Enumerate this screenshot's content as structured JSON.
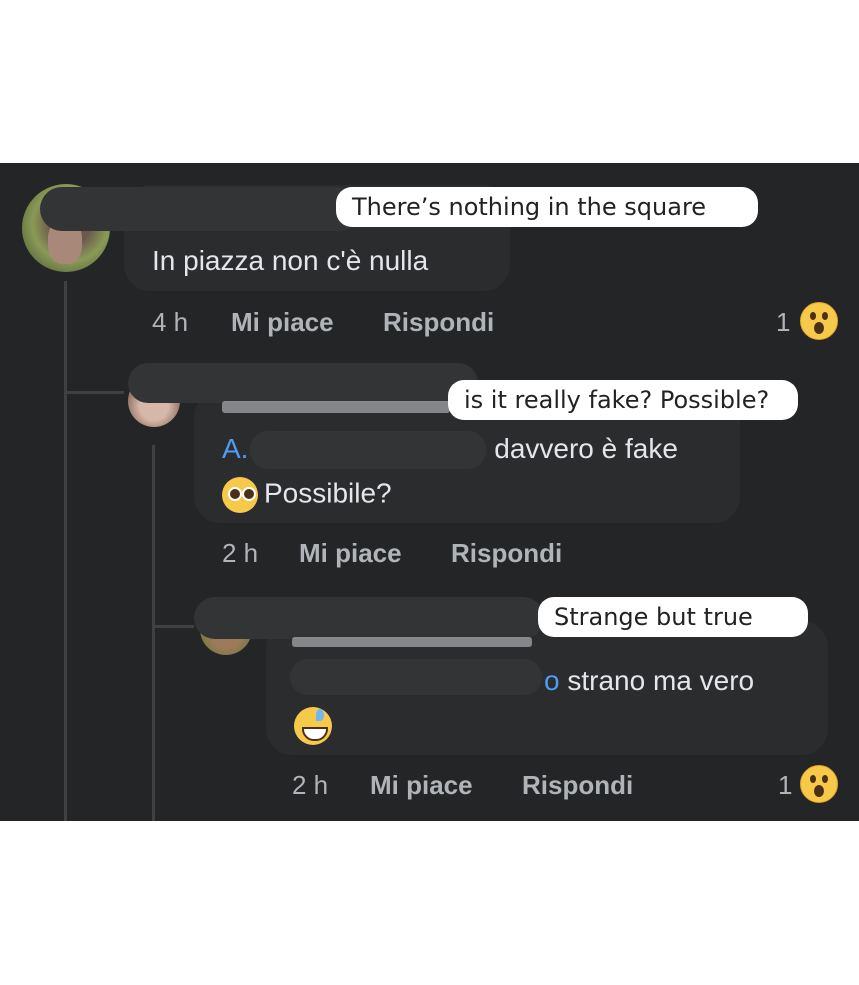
{
  "comments": [
    {
      "translation": "There’s nothing in the square",
      "text": "In piazza non c'è nulla",
      "time": "4 h",
      "like_label": "Mi piace",
      "reply_label": "Rispondi",
      "reaction_count": "1",
      "reaction_icon": "wow-emoji-icon"
    },
    {
      "translation": "is it really fake? Possible?",
      "mention": "A.",
      "text_after_mention": " davvero è fake",
      "text_line2": "Possibile?",
      "time": "2 h",
      "like_label": "Mi piace",
      "reply_label": "Rispondi",
      "emoji": "pleading-face-icon"
    },
    {
      "translation": "Strange but true",
      "mention": "o",
      "text_after_mention": " strano ma vero",
      "time": "2 h",
      "like_label": "Mi piace",
      "reply_label": "Rispondi",
      "reaction_count": "1",
      "reaction_icon": "wow-emoji-icon",
      "emoji": "grinning-sweat-icon"
    }
  ],
  "colors": {
    "background": "#242526",
    "bubble": "#2b2c2e",
    "text": "#e4e6eb",
    "meta": "#b0b3b8",
    "mention": "#4f9cf0"
  }
}
